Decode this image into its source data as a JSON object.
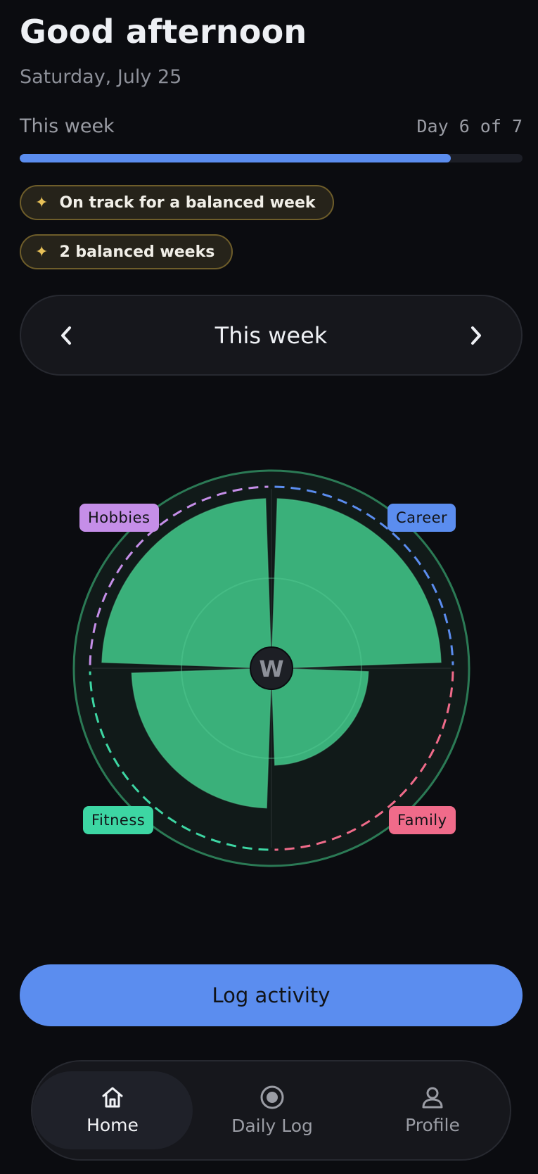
{
  "header": {
    "greeting": "Good afternoon",
    "date": "Saturday, July 25"
  },
  "week_progress": {
    "label": "This week",
    "day_text": "Day 6 of 7",
    "fraction": 0.857,
    "color": "#5b8def"
  },
  "chips": [
    {
      "icon": "sparkle-icon",
      "glyph": "✦",
      "label": "On track for a balanced week"
    },
    {
      "icon": "sparkle-icon",
      "glyph": "✦",
      "label": "2 balanced weeks"
    }
  ],
  "week_nav": {
    "title": "This week",
    "prev_icon": "chevron-left-icon",
    "next_icon": "chevron-right-icon"
  },
  "wheel": {
    "center_letter": "W",
    "segment_color": "#3ab07a",
    "segments": [
      {
        "name": "Career",
        "level": 0.91,
        "color": "#5b8def"
      },
      {
        "name": "Family",
        "level": 0.52,
        "color": "#f06b8a"
      },
      {
        "name": "Fitness",
        "level": 0.75,
        "color": "#3dd6a3"
      },
      {
        "name": "Hobbies",
        "level": 0.91,
        "color": "#c58ee8"
      }
    ]
  },
  "log_button": {
    "label": "Log activity"
  },
  "bottom_nav": {
    "items": [
      {
        "label": "Home",
        "icon": "home-icon",
        "active": true
      },
      {
        "label": "Daily Log",
        "icon": "record-icon",
        "active": false
      },
      {
        "label": "Profile",
        "icon": "user-icon",
        "active": false
      }
    ]
  }
}
